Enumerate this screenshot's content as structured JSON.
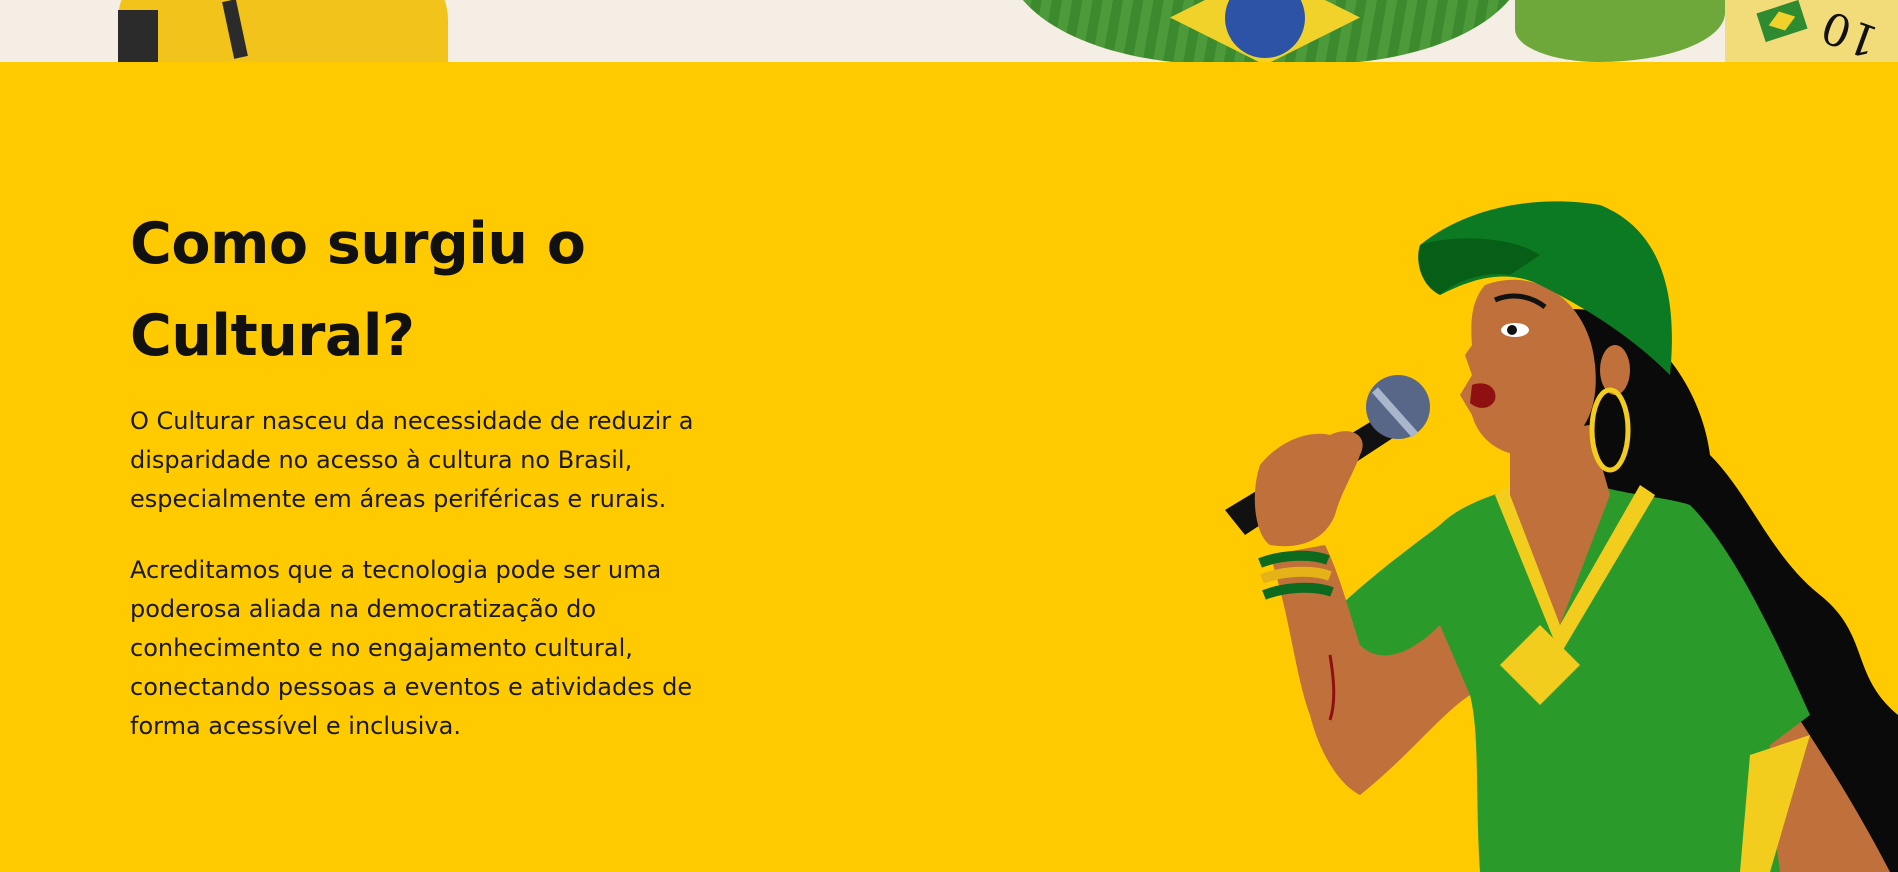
{
  "section": {
    "title": "Como surgiu o Cultural?",
    "paragraphs": [
      "O Culturar nasceu da necessidade de reduzir a disparidade no acesso à cultura no Brasil, especialmente em áreas periféricas e rurais.",
      "Acreditamos que a tecnologia pode ser uma poderosa aliada na democratização do conhecimento e no engajamento cultural, conectando pessoas a eventos e atividades de forma acessível e inclusiva."
    ]
  },
  "colors": {
    "background": "#ffca00",
    "strip": "#f5eee4",
    "green": "#2a9a2b",
    "cap_green": "#0c7a22",
    "skin": "#c0703a",
    "text": "#111111"
  }
}
